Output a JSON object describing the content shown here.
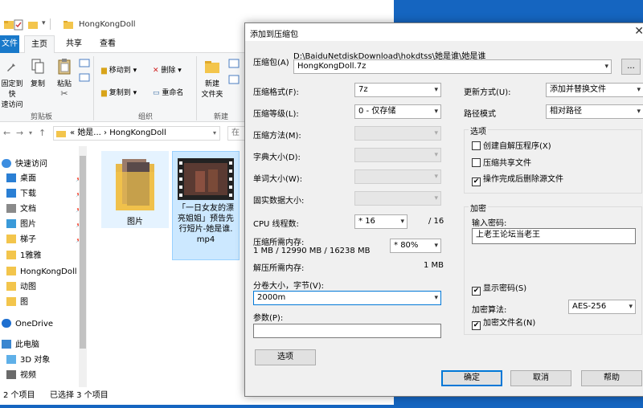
{
  "explorer": {
    "title": "HongKongDoll",
    "ribbon_tabs": [
      "文件",
      "主页",
      "共享",
      "查看"
    ],
    "clipboard": {
      "pin_label_1": "固定到快",
      "pin_label_2": "速访问",
      "copy": "复制",
      "paste": "粘贴",
      "group": "剪贴板"
    },
    "organize": {
      "move_to": "移动到",
      "copy_to": "复制到",
      "delete": "删除",
      "rename": "重命名",
      "group": "组织"
    },
    "new": {
      "new_folder_1": "新建",
      "new_folder_2": "文件夹",
      "group": "新建"
    },
    "address": {
      "path_prefix": "«",
      "path_1": "她是...",
      "path_sep": "›",
      "path_2": "HongKongDoll",
      "search_placeholder": "在"
    },
    "nav": [
      {
        "label": "快速访问",
        "icon": "star-icon"
      },
      {
        "label": "桌面",
        "icon": "desktop-icon",
        "pinned": true
      },
      {
        "label": "下载",
        "icon": "download-icon",
        "pinned": true
      },
      {
        "label": "文档",
        "icon": "document-icon",
        "pinned": true
      },
      {
        "label": "图片",
        "icon": "pictures-icon",
        "pinned": true
      },
      {
        "label": "梯子",
        "icon": "folder-icon",
        "pinned": true
      },
      {
        "label": "1雅雅",
        "icon": "folder-icon"
      },
      {
        "label": "HongKongDoll",
        "icon": "folder-icon"
      },
      {
        "label": "动图",
        "icon": "folder-icon"
      },
      {
        "label": "图",
        "icon": "folder-icon"
      },
      {
        "label": "OneDrive",
        "icon": "cloud-icon"
      },
      {
        "label": "此电脑",
        "icon": "computer-icon"
      },
      {
        "label": "3D 对象",
        "icon": "cube-icon"
      },
      {
        "label": "视频",
        "icon": "video-icon"
      }
    ],
    "files": [
      {
        "name": "图片",
        "type": "folder"
      },
      {
        "name_lines": [
          "「一日女友的漂",
          "亮姐姐」预告先",
          "行短片-她是谁.",
          "mp4"
        ],
        "type": "video"
      }
    ],
    "status": {
      "count": "2 个项目",
      "selected": "已选择 3 个项目"
    }
  },
  "dialog": {
    "title": "添加到压缩包",
    "archive_label": "压缩包(A)",
    "archive_path": "D:\\BaiduNetdiskDownload\\hokdtss\\她是谁\\她是谁",
    "archive_name": "HongKongDoll.7z",
    "browse": "...",
    "format_label": "压缩格式(F):",
    "format_value": "7z",
    "level_label": "压缩等级(L):",
    "level_value": "0 - 仅存储",
    "method_label": "压缩方法(M):",
    "dict_label": "字典大小(D):",
    "word_label": "单词大小(W):",
    "solid_label": "固实数据大小:",
    "cpu_label": "CPU 线程数:",
    "cpu_value": "16",
    "cpu_max": "/ 16",
    "mem_comp_label": "压缩所需内存:",
    "mem_comp_value": "1 MB / 12990 MB / 16238 MB",
    "mem_percent": "80%",
    "mem_decomp_label": "解压所需内存:",
    "mem_decomp_value": "1 MB",
    "split_label": "分卷大小，字节(V):",
    "split_value": "2000m",
    "params_label": "参数(P):",
    "params_value": "",
    "options_button": "选项",
    "update_label": "更新方式(U):",
    "update_value": "添加并替换文件",
    "path_mode_label": "路径模式",
    "path_mode_value": "相对路径",
    "options_group": "选项",
    "opt_sfx": "创建自解压程序(X)",
    "opt_shared": "压缩共享文件",
    "opt_delete": "操作完成后删除源文件",
    "encrypt_group": "加密",
    "password_label": "输入密码:",
    "password_value": "上老王论坛当老王",
    "show_password": "显示密码(S)",
    "enc_method_label": "加密算法:",
    "enc_method_value": "AES-256",
    "encrypt_names": "加密文件名(N)",
    "ok": "确定",
    "cancel": "取消",
    "help": "帮助"
  }
}
